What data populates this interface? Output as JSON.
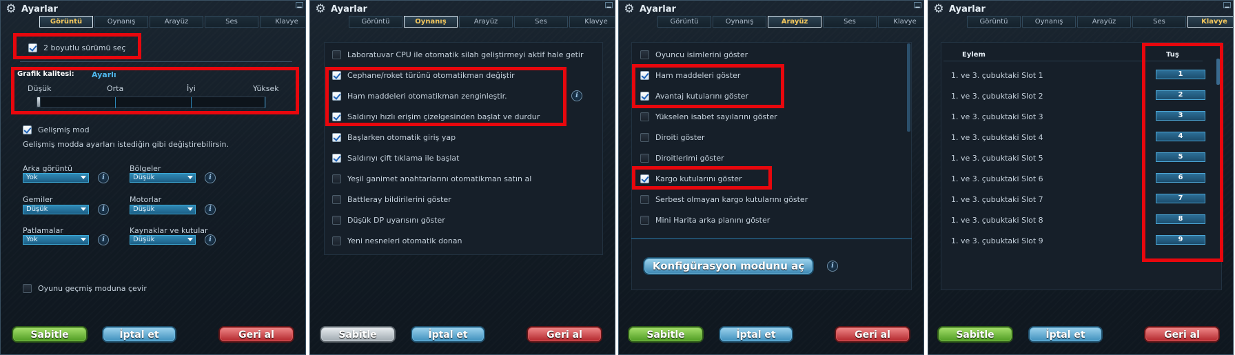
{
  "window": {
    "title": "Ayarlar"
  },
  "tabs": [
    "Görüntü",
    "Oynanış",
    "Arayüz",
    "Ses",
    "Klavye"
  ],
  "buttons": {
    "apply": "Sabitle",
    "cancel": "İptal et",
    "revert": "Geri al"
  },
  "panel1": {
    "active_tab": "Görüntü",
    "twod_label": "2 boyutlu sürümü seç",
    "twod_checked": true,
    "quality_label": "Grafik kalitesi:",
    "quality_value": "Ayarlı",
    "quality_levels": [
      "Düşük",
      "Orta",
      "İyi",
      "Yüksek"
    ],
    "advanced_label": "Gelişmiş mod",
    "advanced_checked": true,
    "advanced_desc": "Gelişmiş modda ayarları istediğin gibi değiştirebilirsin.",
    "selects": [
      {
        "label": "Arka görüntü",
        "value": "Yok"
      },
      {
        "label": "Bölgeler",
        "value": "Düşük"
      },
      {
        "label": "Gemiler",
        "value": "Düşük"
      },
      {
        "label": "Motorlar",
        "value": "Düşük"
      },
      {
        "label": "Patlamalar",
        "value": "Yok"
      },
      {
        "label": "Kaynaklar ve kutular",
        "value": "Düşük"
      }
    ],
    "legacy_label": "Oyunu geçmiş moduna çevir",
    "legacy_checked": false
  },
  "panel2": {
    "active_tab": "Oynanış",
    "options": [
      {
        "label": "Laboratuvar CPU ile otomatik silah geliştirmeyi aktif hale getir",
        "checked": false
      },
      {
        "label": "Cephane/roket türünü otomatikman değiştir",
        "checked": true
      },
      {
        "label": "Ham maddeleri otomatikman zenginleştir.",
        "checked": true
      },
      {
        "label": "Saldırıyı hızlı erişim çizelgesinden başlat ve durdur",
        "checked": true
      },
      {
        "label": "Başlarken otomatik giriş yap",
        "checked": true
      },
      {
        "label": "Saldırıyı çift tıklama ile başlat",
        "checked": true
      },
      {
        "label": "Yeşil ganimet anahtarlarını otomatikman satın al",
        "checked": false
      },
      {
        "label": "Battleray bildirilerini göster",
        "checked": false
      },
      {
        "label": "Düşük DP uyarısını göster",
        "checked": false
      },
      {
        "label": "Yeni nesneleri otomatik donan",
        "checked": false
      }
    ]
  },
  "panel3": {
    "active_tab": "Arayüz",
    "options": [
      {
        "label": "Oyuncu isimlerini göster",
        "checked": false
      },
      {
        "label": "Ham maddeleri göster",
        "checked": true
      },
      {
        "label": "Avantaj kutularını göster",
        "checked": true
      },
      {
        "label": "Yükselen isabet sayılarını göster",
        "checked": false
      },
      {
        "label": "Diroiti göster",
        "checked": false
      },
      {
        "label": "Diroitlerimi göster",
        "checked": false
      },
      {
        "label": "Kargo kutularını göster",
        "checked": true
      },
      {
        "label": "Serbest olmayan kargo kutularını göster",
        "checked": false
      },
      {
        "label": "Mini Harita arka planını göster",
        "checked": false
      }
    ],
    "config_button": "Konfigürasyon modunu aç"
  },
  "panel4": {
    "active_tab": "Klavye",
    "col_action": "Eylem",
    "col_key": "Tuş",
    "rows": [
      {
        "action": "1. ve 3. çubuktaki Slot 1",
        "key": "1"
      },
      {
        "action": "1. ve 3. çubuktaki Slot 2",
        "key": "2"
      },
      {
        "action": "1. ve 3. çubuktaki Slot 3",
        "key": "3"
      },
      {
        "action": "1. ve 3. çubuktaki Slot 4",
        "key": "4"
      },
      {
        "action": "1. ve 3. çubuktaki Slot 5",
        "key": "5"
      },
      {
        "action": "1. ve 3. çubuktaki Slot 6",
        "key": "6"
      },
      {
        "action": "1. ve 3. çubuktaki Slot 7",
        "key": "7"
      },
      {
        "action": "1. ve 3. çubuktaki Slot 8",
        "key": "8"
      },
      {
        "action": "1. ve 3. çubuktaki Slot 9",
        "key": "9"
      }
    ]
  }
}
